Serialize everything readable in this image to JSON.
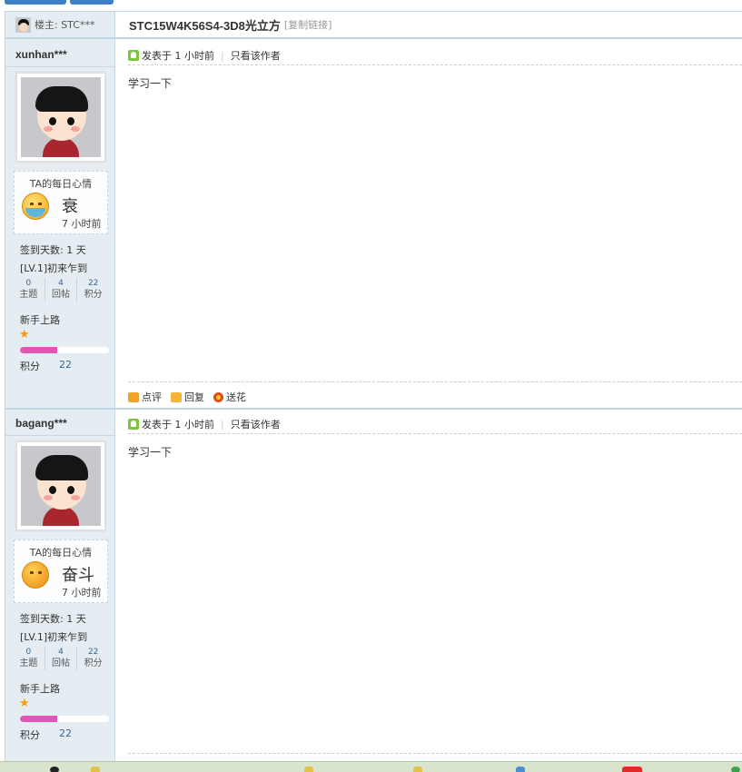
{
  "thread": {
    "op_label": "楼主: STC***",
    "title": "STC15W4K56S4-3D8光立方",
    "copy_link": "[复制链接]"
  },
  "posts": [
    {
      "username": "xunhan***",
      "mood": {
        "title": "TA的每日心情",
        "icon": "crying-face-icon",
        "text": "衰",
        "time": "7 小时前"
      },
      "sign_days": "签到天数: 1 天",
      "level": "[LV.1]初来乍到",
      "stats": [
        {
          "value": "0",
          "label": "主题"
        },
        {
          "value": "4",
          "label": "回帖"
        },
        {
          "value": "22",
          "label": "积分"
        }
      ],
      "rank": "新手上路",
      "stars": 1,
      "credit_progress": 0.42,
      "credit_label": "积分",
      "credit_value": "22",
      "posted": "发表于 1 小时前",
      "author_only": "只看该作者",
      "content": "学习一下",
      "actions": {
        "comment": "点评",
        "reply": "回复",
        "flower": "送花"
      }
    },
    {
      "username": "bagang***",
      "mood": {
        "title": "TA的每日心情",
        "icon": "striving-face-icon",
        "text": "奋斗",
        "time": "7 小时前"
      },
      "sign_days": "签到天数: 1 天",
      "level": "[LV.1]初来乍到",
      "stats": [
        {
          "value": "0",
          "label": "主题"
        },
        {
          "value": "4",
          "label": "回帖"
        },
        {
          "value": "22",
          "label": "积分"
        }
      ],
      "rank": "新手上路",
      "stars": 1,
      "credit_progress": 0.42,
      "credit_label": "积分",
      "credit_value": "22",
      "posted": "发表于 1 小时前",
      "author_only": "只看该作者",
      "content": "学习一下"
    }
  ],
  "colors": {
    "sidebar_bg": "#e5edf2",
    "border": "#c2d5e3",
    "accent_blue": "#3b7fc4",
    "credit_bar": "#e255b4",
    "star": "#f59b0c"
  }
}
